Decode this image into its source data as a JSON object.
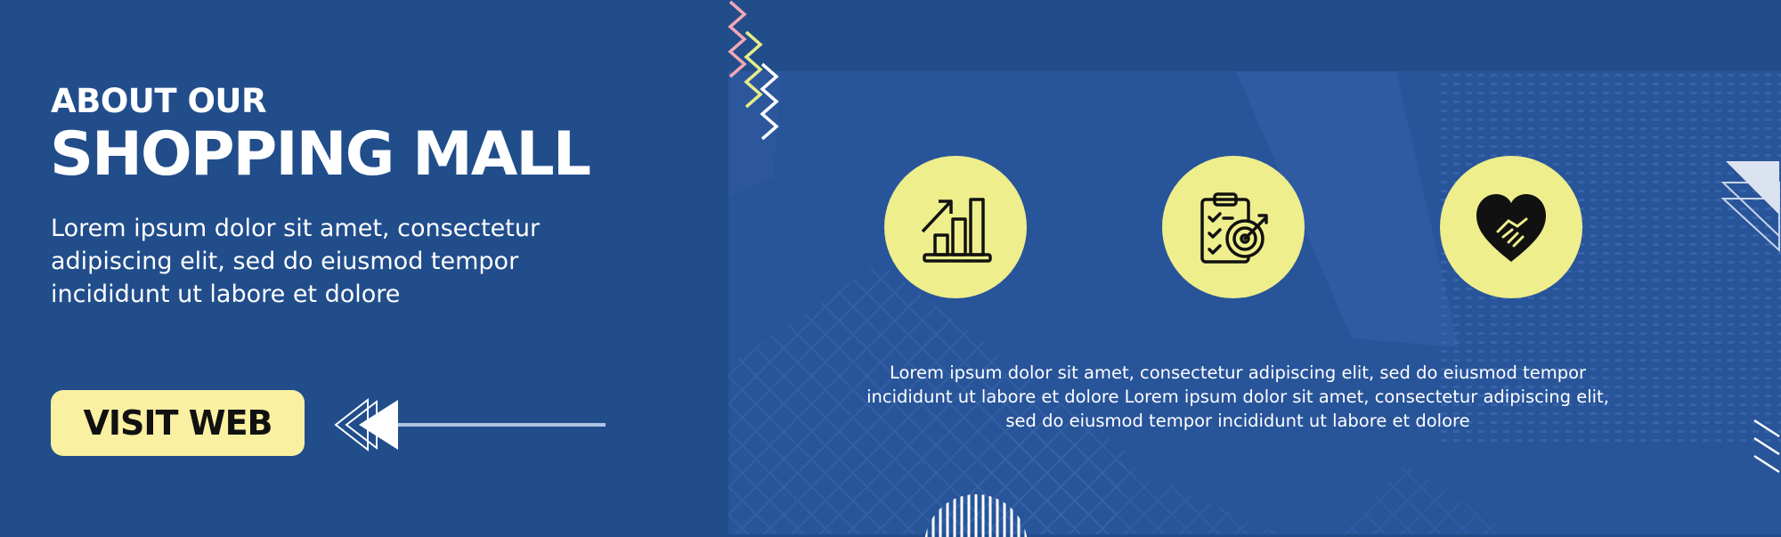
{
  "hero": {
    "eyebrow": "ABOUT OUR",
    "title": "SHOPPING MALL",
    "description": "Lorem ipsum dolor sit amet, consectetur adipiscing elit, sed do eiusmod tempor incididunt ut labore et dolore",
    "cta_label": "VISIT WEB"
  },
  "features": {
    "icons": [
      "bar-chart-growth-icon",
      "clipboard-target-icon",
      "heart-handshake-icon"
    ],
    "body": "Lorem ipsum dolor sit amet, consectetur adipiscing elit, sed do eiusmod tempor incididunt ut labore et dolore Lorem ipsum dolor sit amet, consectetur adipiscing elit, sed do eiusmod tempor incididunt ut labore et dolore"
  },
  "colors": {
    "background": "#214D8B",
    "accent_yellow": "#EEEE8D",
    "button_yellow": "#FAF0A1",
    "zigzag_pink": "#F2A7B5",
    "zigzag_yellow": "#E6EC8A",
    "text": "#FFFFFF"
  }
}
